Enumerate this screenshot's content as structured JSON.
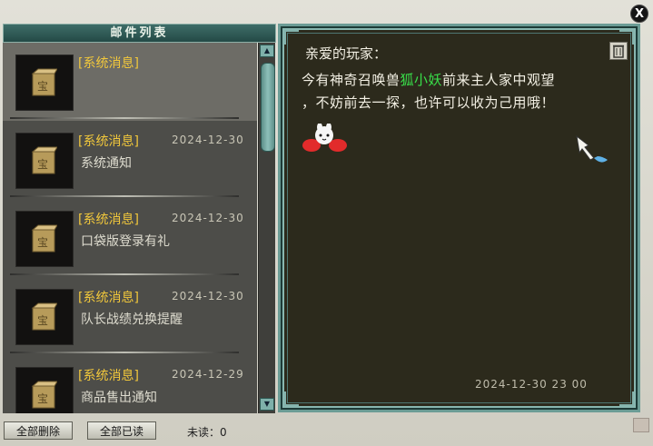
{
  "window": {
    "title": "邮件列表",
    "close_symbol": "X"
  },
  "mail_list": [
    {
      "tag": "[系统消息]",
      "date": "",
      "subject": "",
      "selected": true
    },
    {
      "tag": "[系统消息]",
      "date": "2024-12-30",
      "subject": "系统通知",
      "selected": false
    },
    {
      "tag": "[系统消息]",
      "date": "2024-12-30",
      "subject": "口袋版登录有礼",
      "selected": false
    },
    {
      "tag": "[系统消息]",
      "date": "2024-12-30",
      "subject": "队长战绩兑换提醒",
      "selected": false
    },
    {
      "tag": "[系统消息]",
      "date": "2024-12-29",
      "subject": "商品售出通知",
      "selected": false
    }
  ],
  "buttons": {
    "delete_all": "全部删除",
    "read_all": "全部已读"
  },
  "unread_label": "未读：0",
  "message": {
    "greeting": "亲爱的玩家：",
    "line1_prefix": "今有神奇召唤兽",
    "line1_highlight": "狐小妖",
    "line1_suffix": "前来主人家中观望",
    "line2": "，不妨前去一探，也许可以收为己用哦！",
    "timestamp": "2024-12-30 23 00"
  },
  "icons": {
    "mail_item": "gold-box-icon",
    "trash": "trash-icon",
    "sticker": "bunny-sticker-icon",
    "cursor": "arrow-cursor-icon"
  },
  "colors": {
    "tag": "#f2c83b",
    "highlight": "#39e04a",
    "panel_border": "#6b9c95"
  }
}
